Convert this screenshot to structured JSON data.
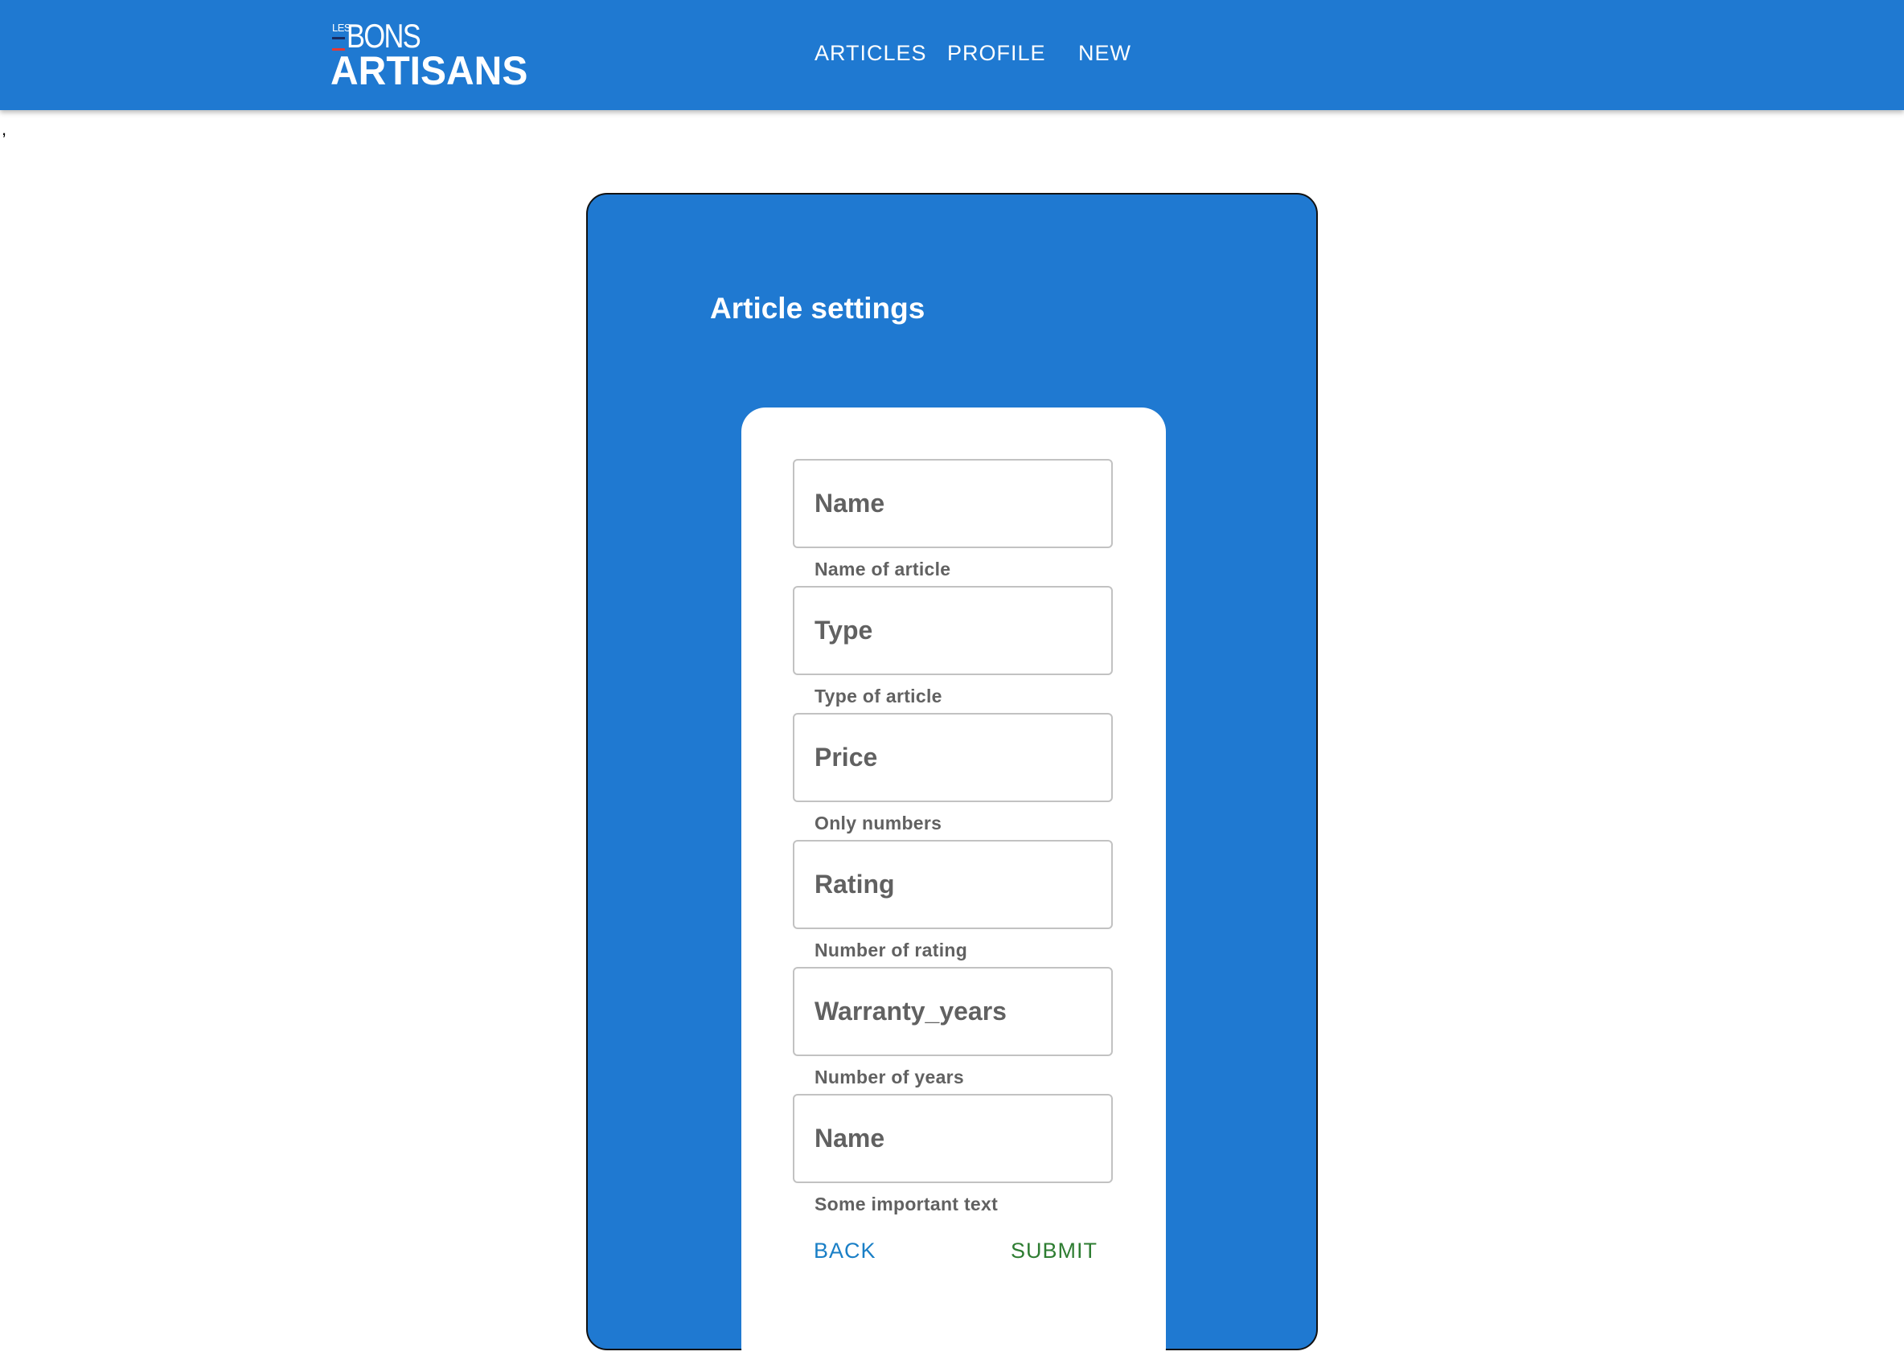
{
  "logo": {
    "small_text": "LES",
    "line1": "BONS",
    "line2": "ARTISANS"
  },
  "nav": {
    "items": [
      "ARTICLES",
      "PROFILE",
      "NEW"
    ]
  },
  "stray_text": ",",
  "form": {
    "title": "Article settings",
    "fields": [
      {
        "placeholder": "Name",
        "helper": "Name of article"
      },
      {
        "placeholder": "Type",
        "helper": "Type of article"
      },
      {
        "placeholder": "Price",
        "helper": "Only numbers"
      },
      {
        "placeholder": "Rating",
        "helper": "Number of rating"
      },
      {
        "placeholder": "Warranty_years",
        "helper": "Number of years"
      },
      {
        "placeholder": "Name",
        "helper": "Some important text"
      }
    ],
    "back_label": "BACK",
    "submit_label": "SUBMIT"
  },
  "colors": {
    "primary": "#1f79d1",
    "back_button": "#1a7fc6",
    "submit_button": "#2e7d32",
    "field_text": "#616161"
  }
}
